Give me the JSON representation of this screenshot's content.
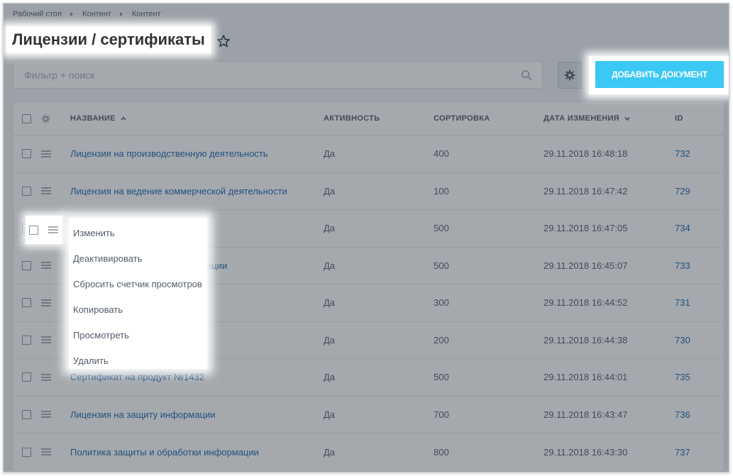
{
  "breadcrumb": [
    "Рабочий стол",
    "Контент",
    "Контент"
  ],
  "page_title": "Лицензии / сертификаты",
  "filter": {
    "placeholder": "Фильтр + поиск"
  },
  "add_button_label": "ДОБАВИТЬ ДОКУМЕНТ",
  "table": {
    "headers": {
      "name": "НАЗВАНИЕ",
      "active": "АКТИВНОСТЬ",
      "sort": "СОРТИРОВКА",
      "date": "ДАТА ИЗМЕНЕНИЯ",
      "id": "ID"
    },
    "rows": [
      {
        "name": "Лицензия на производственную деятельность",
        "active": "Да",
        "sort": "400",
        "date": "29.11.2018 16:48:18",
        "id": "732"
      },
      {
        "name": "Лицензия на ведение коммерческой деятельности",
        "active": "Да",
        "sort": "100",
        "date": "29.11.2018 16:47:42",
        "id": "729"
      },
      {
        "name": "",
        "active": "Да",
        "sort": "500",
        "date": "29.11.2018 16:47:05",
        "id": "734"
      },
      {
        "name": "ации",
        "active": "Да",
        "sort": "500",
        "date": "29.11.2018 16:45:07",
        "id": "733"
      },
      {
        "name": "",
        "active": "Да",
        "sort": "300",
        "date": "29.11.2018 16:44:52",
        "id": "731"
      },
      {
        "name": "",
        "active": "Да",
        "sort": "200",
        "date": "29.11.2018 16:44:38",
        "id": "730"
      },
      {
        "name": "Сертификат на продукт №1432",
        "active": "Да",
        "sort": "500",
        "date": "29.11.2018 16:44:01",
        "id": "735"
      },
      {
        "name": "Лицензия на защиту информации",
        "active": "Да",
        "sort": "700",
        "date": "29.11.2018 16:43:47",
        "id": "736"
      },
      {
        "name": "Политика защиты и обработки информации",
        "active": "Да",
        "sort": "800",
        "date": "29.11.2018 16:43:30",
        "id": "737"
      }
    ]
  },
  "context_menu": [
    "Изменить",
    "Деактивировать",
    "Сбросить счетчик просмотров",
    "Копировать",
    "Просмотреть",
    "Удалить"
  ],
  "colors": {
    "accent": "#3bc8f5",
    "link": "#2067b0",
    "overlay": "rgba(40,50,60,0.42)"
  }
}
